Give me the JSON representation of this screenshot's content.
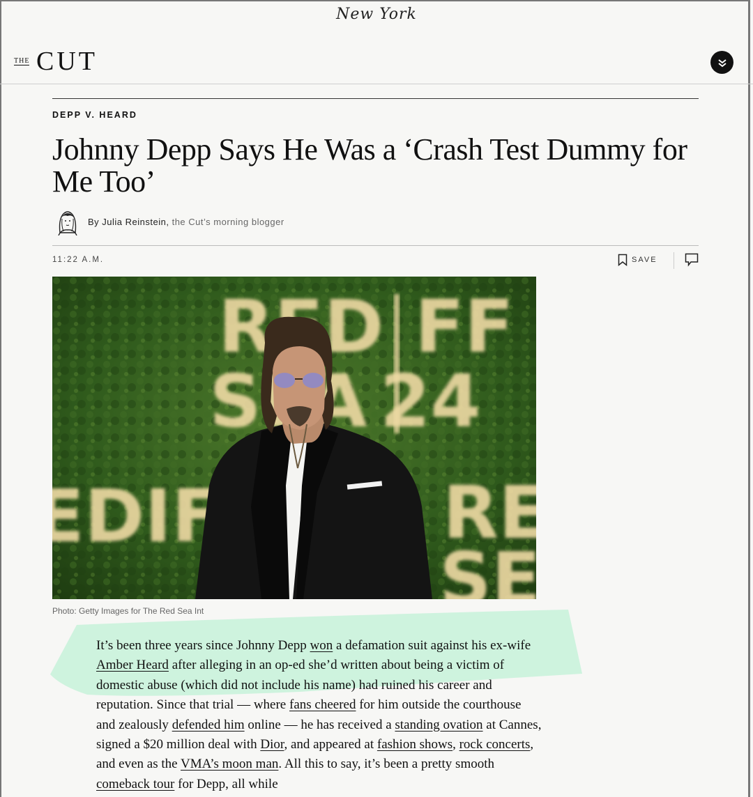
{
  "header": {
    "nymag": "New York",
    "logo_the": "THE",
    "logo_cut": "CUT"
  },
  "article": {
    "rubric": "DEPP V. HEARD",
    "headline": "Johnny Depp Says He Was a ‘Crash Test Dummy for Me Too’",
    "byline_prefix": "By",
    "author": "Julia Reinstein",
    "author_role": "the Cut’s morning blogger",
    "timestamp": "11:22 A.M.",
    "save_label": "SAVE",
    "photo_credit": "Photo: Getty Images for The Red Sea Int",
    "photo_sign": {
      "l1": "RED",
      "l2": "FF",
      "l3": "SEA",
      "l4": "24",
      "l5": "EDIFF",
      "l6": "RE",
      "l7": "SE"
    },
    "body": {
      "t1": "It’s been three years since Johnny Depp ",
      "a1": "won",
      "t2": " a defamation suit against his ex-wife ",
      "a2": "Amber Heard",
      "t3": " after alleging in an op-ed she’d written about being a victim of domestic abuse (which did not include his name) had ruined his career and reputation. Since that trial — where ",
      "a3": "fans cheered",
      "t4": " for him outside the courthouse and zealously ",
      "a4": "defended him",
      "t5": " online — he has received a ",
      "a5": "standing ovation",
      "t6": " at Cannes, signed a $20 million deal with ",
      "a6": "Dior",
      "t7": ", and appeared at ",
      "a7": "fashion shows",
      "t8": ", ",
      "a8": "rock concerts",
      "t9": ", and even as the ",
      "a9": "VMA’s moon man",
      "t10": ". All this to say, it’s been a pretty smooth ",
      "a10": "comeback tour",
      "t11": " for Depp, all while"
    }
  },
  "colors": {
    "highlight": "#c9f2dc",
    "text": "#111111"
  },
  "icons": [
    "menu-chevrons-icon",
    "bookmark-icon",
    "comment-icon"
  ]
}
